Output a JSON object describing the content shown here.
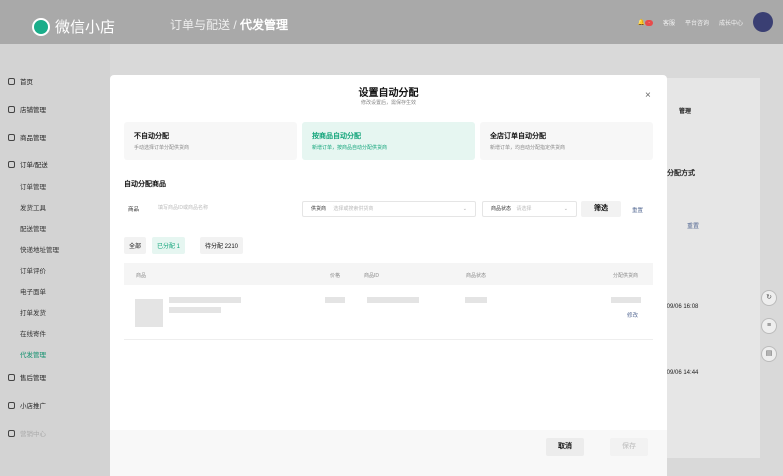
{
  "app": {
    "name": "微信小店"
  },
  "header": {
    "breadcrumb_parent": "订单与配送 /",
    "breadcrumb_current": "代发管理",
    "items": [
      "客服",
      "平台咨询",
      "成长中心"
    ]
  },
  "sidebar": {
    "items": [
      {
        "label": "首页"
      },
      {
        "label": "店铺管理"
      },
      {
        "label": "商品管理"
      },
      {
        "label": "订单/配送"
      },
      {
        "label": "订单管理"
      },
      {
        "label": "发货工具"
      },
      {
        "label": "配送管理"
      },
      {
        "label": "快递地址管理"
      },
      {
        "label": "订单评价"
      },
      {
        "label": "电子面单"
      },
      {
        "label": "打单发货"
      },
      {
        "label": "在线寄件"
      },
      {
        "label": "代发管理"
      },
      {
        "label": "售后管理"
      },
      {
        "label": "小店推广"
      },
      {
        "label": "营销中心"
      }
    ]
  },
  "background_right": {
    "manage": "管理",
    "distribution_mode": "分配方式",
    "reset": "重置",
    "time1": "/09/06 16:08",
    "time2": "/09/06 14:44"
  },
  "modal": {
    "title": "设置自动分配",
    "subtitle": "修改设置后，需保存生效",
    "options": [
      {
        "title": "不自动分配",
        "desc": "手动选择订单分配供货商"
      },
      {
        "title": "按商品自动分配",
        "desc": "新增订单，按商品自动分配供货商"
      },
      {
        "title": "全店订单自动分配",
        "desc": "新增订单，均自动分配指定供货商"
      }
    ],
    "section_title": "自动分配商品",
    "filters": {
      "product_label": "商品",
      "product_placeholder": "填写商品ID或商品名称",
      "supplier_label": "供货商",
      "supplier_placeholder": "选择或搜索供货商",
      "status_label": "商品状态",
      "status_placeholder": "请选择",
      "filter_button": "筛选",
      "reset_button": "重置"
    },
    "tabs": [
      {
        "label": "全部"
      },
      {
        "label": "已分配 1"
      },
      {
        "label": "待分配 2210"
      }
    ],
    "table": {
      "columns": [
        "商品",
        "价格",
        "商品ID",
        "商品状态",
        "分配供货商"
      ],
      "row_action": "修改"
    },
    "footer": {
      "cancel": "取消",
      "save": "保存"
    }
  }
}
